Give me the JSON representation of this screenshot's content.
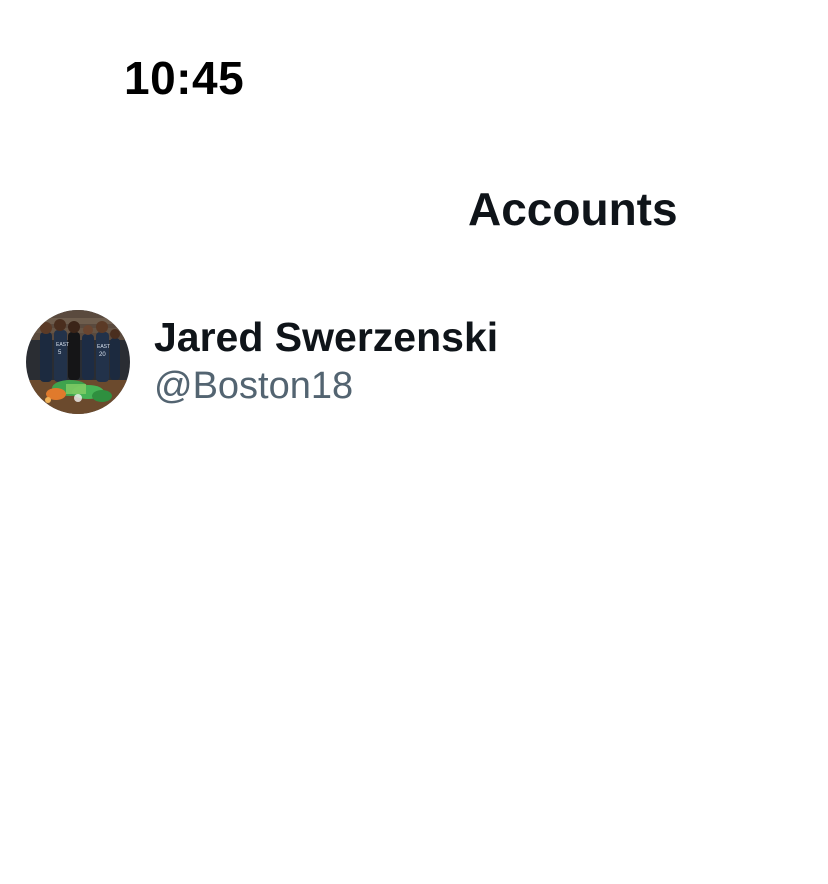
{
  "status_bar": {
    "time": "10:45"
  },
  "header": {
    "title": "Accounts"
  },
  "accounts": [
    {
      "name": "Jared Swerzenski",
      "handle": "@Boston18",
      "avatar_icon": "avatar-photo-basketball-team",
      "jersey_numbers": [
        "5",
        "20"
      ],
      "jersey_text": [
        "EAST",
        "EAST"
      ]
    }
  ],
  "colors": {
    "text_primary": "#0f1419",
    "text_secondary": "#536471",
    "background": "#ffffff"
  }
}
